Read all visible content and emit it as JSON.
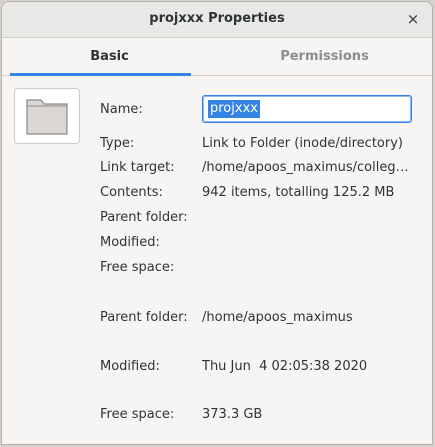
{
  "window": {
    "title": "projxxx Properties",
    "close_glyph": "×"
  },
  "tabs": [
    {
      "label": "Basic",
      "active": true
    },
    {
      "label": "Permissions",
      "active": false
    }
  ],
  "icon": {
    "name": "folder-icon"
  },
  "fields": {
    "name_label": "Name:",
    "name_value": "projxxx",
    "type_label": "Type:",
    "type_value": "Link to Folder (inode/directory)",
    "link_target_label": "Link target:",
    "link_target_value": "/home/apoos_maximus/colleg…",
    "contents_label": "Contents:",
    "contents_value": "942 items, totalling 125.2 MB",
    "parent_folder_label": "Parent folder:",
    "modified_label": "Modified:",
    "free_space_label": "Free space:",
    "parent_folder_label_2": "Parent folder:",
    "parent_folder_value_2": "/home/apoos_maximus",
    "modified_label_2": "Modified:",
    "modified_value_2": "Thu Jun  4 02:05:38 2020",
    "free_space_label_2": "Free space:",
    "free_space_value_2": "373.3 GB"
  },
  "colors": {
    "accent": "#3584e4",
    "background": "#f6f5f4",
    "titlebar": "#e8e8e7"
  }
}
